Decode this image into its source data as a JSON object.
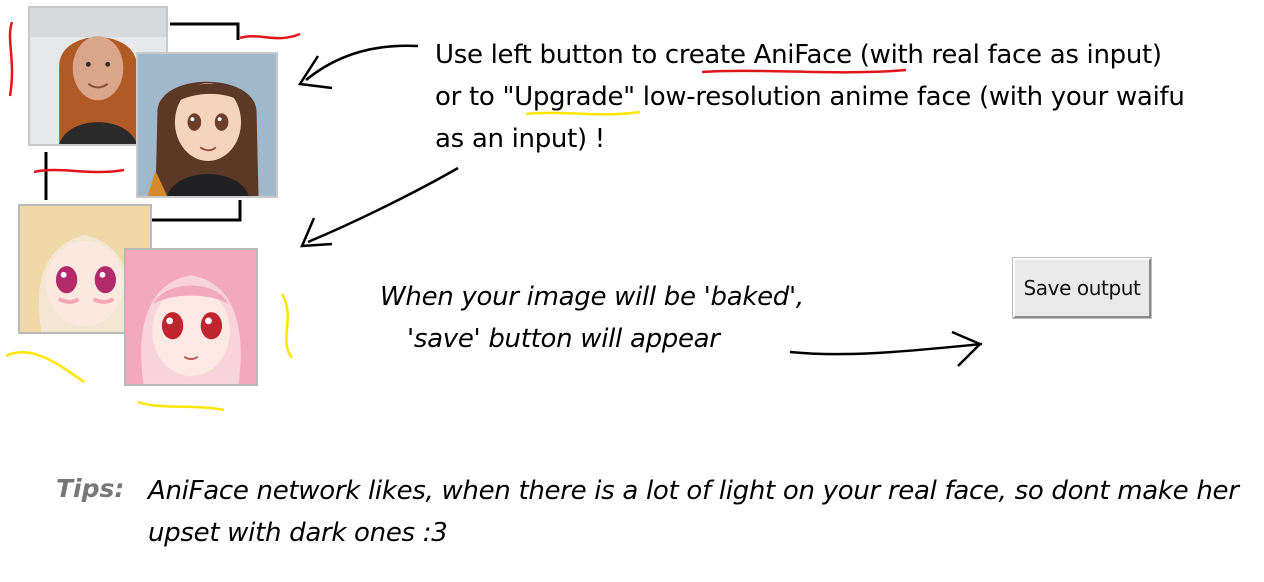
{
  "instructions": {
    "part1": "Use left button to ",
    "create_link": "create AniFace",
    "part2": " (with real face as input)",
    "part3": "or to ",
    "upgrade_link": "\"Upgrade\"",
    "part4": " low-resolution anime face (with your waifu",
    "part5": "as an input) !"
  },
  "baked_note": {
    "line1": "When your image will be 'baked',",
    "line2": "'save' button will appear"
  },
  "save_button": {
    "label": "Save output"
  },
  "tips": {
    "label": "Tips:",
    "text": "AniFace network likes, when there is a lot of light on your real face, so dont make her upset with dark ones :3"
  },
  "colors": {
    "red_scribble": "#e0161b",
    "yellow_scribble": "#ffe600",
    "ink": "#000000",
    "tips_gray": "#777777"
  },
  "icons": [
    "real-face-photo",
    "anime-face-output",
    "low-res-anime-face",
    "upgraded-anime-face",
    "arrow-icon"
  ]
}
